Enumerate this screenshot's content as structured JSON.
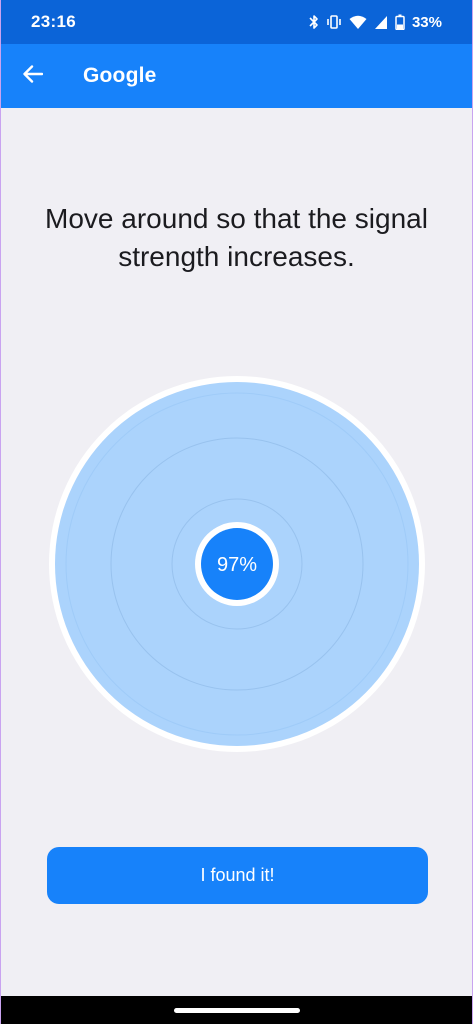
{
  "status_bar": {
    "time": "23:16",
    "battery": "33%",
    "icons": [
      "bluetooth-icon",
      "vibrate-icon",
      "wifi-icon",
      "cell-signal-icon",
      "battery-icon"
    ]
  },
  "app_bar": {
    "title": "Google",
    "back_icon": "arrow-left-icon"
  },
  "main": {
    "instruction": "Move around so that the signal strength increases.",
    "signal_strength": "97%",
    "signal_fraction": 0.97
  },
  "actions": {
    "found_label": "I found it!"
  },
  "colors": {
    "status_bar": "#0b64d8",
    "app_bar": "#1782fa",
    "accent": "#1782fa",
    "radar_fill": "#abd3fc",
    "background": "#f0eff4"
  }
}
